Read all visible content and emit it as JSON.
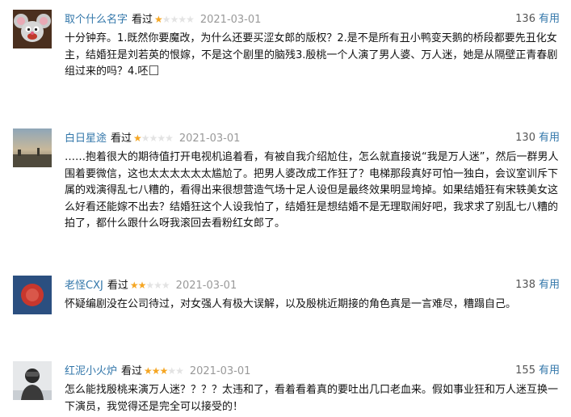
{
  "colors": {
    "link": "#3377aa",
    "star_on": "#f5a623",
    "star_off": "#e3e3e3",
    "date": "#999999"
  },
  "reviews": [
    {
      "user": "取个什么名字",
      "status": "看过",
      "rating": 1,
      "rating_max": 5,
      "date": "2021-03-01",
      "votes": "136",
      "useful_label": "有用",
      "avatar": "cartoon-mouse-avatar",
      "text": "十分钟弃。1.既然你要魔改，为什么还要买涩女郎的版权？2.是不是所有丑小鸭变天鹅的桥段都要先丑化女主，结婚狂是刘若英的恨嫁，不是这个剧里的脑残3.殷桃一个人演了男人婆、万人迷，她是从隔壁正青春剧组过来的吗？4.呸"
    },
    {
      "user": "白日星途",
      "status": "看过",
      "rating": 1,
      "rating_max": 5,
      "date": "2021-03-01",
      "votes": "130",
      "useful_label": "有用",
      "avatar": "sky-landscape-avatar",
      "text": "……抱着很大的期待值打开电视机追着看，有被自我介绍尬住，怎么就直接说“我是万人迷”，然后一群男人围着要微信，这也太太太太太太尴尬了。把男人婆改成工作狂了？电梯那段真好可怕一独白，会议室训斥下属的戏演得乱七八糟的，看得出来很想营造气场十足人设但是最终效果明显垮掉。如果结婚狂有宋轶美女这么好看还能嫁不出去？结婚狂这个人设我怕了，结婚狂是想结婚不是无理取闹好吧，我求求了别乱七八糟的拍了，都什么跟什么呀我滚回去看粉红女郎了。"
    },
    {
      "user": "老怪CXJ",
      "status": "看过",
      "rating": 2,
      "rating_max": 5,
      "date": "2021-03-01",
      "votes": "138",
      "useful_label": "有用",
      "avatar": "red-circle-avatar",
      "text": "怀疑编剧没在公司待过，对女强人有极大误解，以及殷桃近期接的角色真是一言难尽，糟蹋自己。"
    },
    {
      "user": "红泥小火炉",
      "status": "看过",
      "rating": 3,
      "rating_max": 5,
      "date": "2021-03-01",
      "votes": "155",
      "useful_label": "有用",
      "avatar": "person-photo-avatar",
      "text": "怎么能找殷桃来演万人迷？？？？太违和了，看着看着真的要吐出几口老血来。假如事业狂和万人迷互换一下演员，我觉得还是完全可以接受的！"
    }
  ]
}
